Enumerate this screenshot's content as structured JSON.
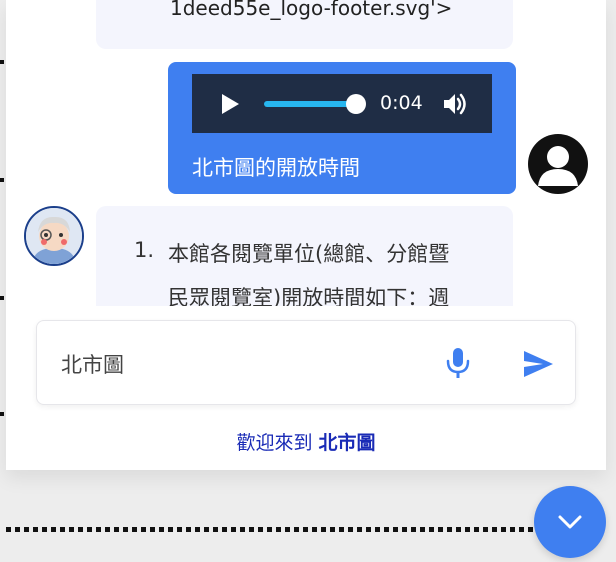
{
  "messages": {
    "bot_snippet": "1deed55e_logo-footer.svg'>",
    "user_message": {
      "audio": {
        "time": "0:04",
        "progress": 1.0,
        "play_icon": "play-icon",
        "volume_icon": "volume-icon"
      },
      "text": "北市圖的開放時間"
    },
    "bot_reply": {
      "list_number": "1.",
      "line_1": "本館各閱覽單位(總館、分館暨",
      "line_2": "民眾閱覽室)開放時間如下：週"
    }
  },
  "composer": {
    "input_value": "北市圖",
    "mic_icon": "microphone-icon",
    "send_icon": "send-icon"
  },
  "footer": {
    "welcome_prefix": "歡迎來到 ",
    "welcome_link": "北市圖"
  },
  "fab": {
    "icon": "chevron-down-icon"
  },
  "colors": {
    "accent": "#3f7ff0",
    "bubble": "#f4f5fd",
    "player": "#1f2d45",
    "link": "#1a2bb6"
  }
}
